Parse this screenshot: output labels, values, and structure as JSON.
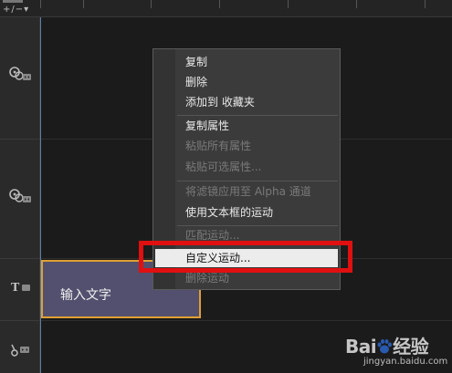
{
  "ruler": {
    "zoom_control": "+/−▾"
  },
  "tracks": [
    {
      "icon": "video-overlay-track-icon"
    },
    {
      "icon": "video-overlay-track-icon"
    },
    {
      "icon": "title-track-icon",
      "label": "T"
    },
    {
      "icon": "audio-track-icon"
    }
  ],
  "clip": {
    "label": "输入文字"
  },
  "context_menu": {
    "items": [
      {
        "label": "复制",
        "enabled": true
      },
      {
        "label": "删除",
        "enabled": true
      },
      {
        "label": "添加到 收藏夹",
        "enabled": true
      },
      {
        "label": "复制属性",
        "enabled": true
      },
      {
        "label": "粘贴所有属性",
        "enabled": false
      },
      {
        "label": "粘贴可选属性...",
        "enabled": false
      },
      {
        "label": "将滤镜应用至 Alpha 通道",
        "enabled": false
      },
      {
        "label": "使用文本框的运动",
        "enabled": true
      },
      {
        "label": "匹配运动...",
        "enabled": false
      },
      {
        "label": "自定义运动...",
        "enabled": true,
        "highlighted": true
      },
      {
        "label": "删除运动",
        "enabled": false
      }
    ]
  },
  "watermark": {
    "brand_left": "Bai",
    "brand_right": "经验",
    "url": "jingyan.baidu.com"
  },
  "colors": {
    "highlight_box": "#e01010",
    "clip_border": "#e0a032",
    "clip_fill": "#52506e"
  }
}
